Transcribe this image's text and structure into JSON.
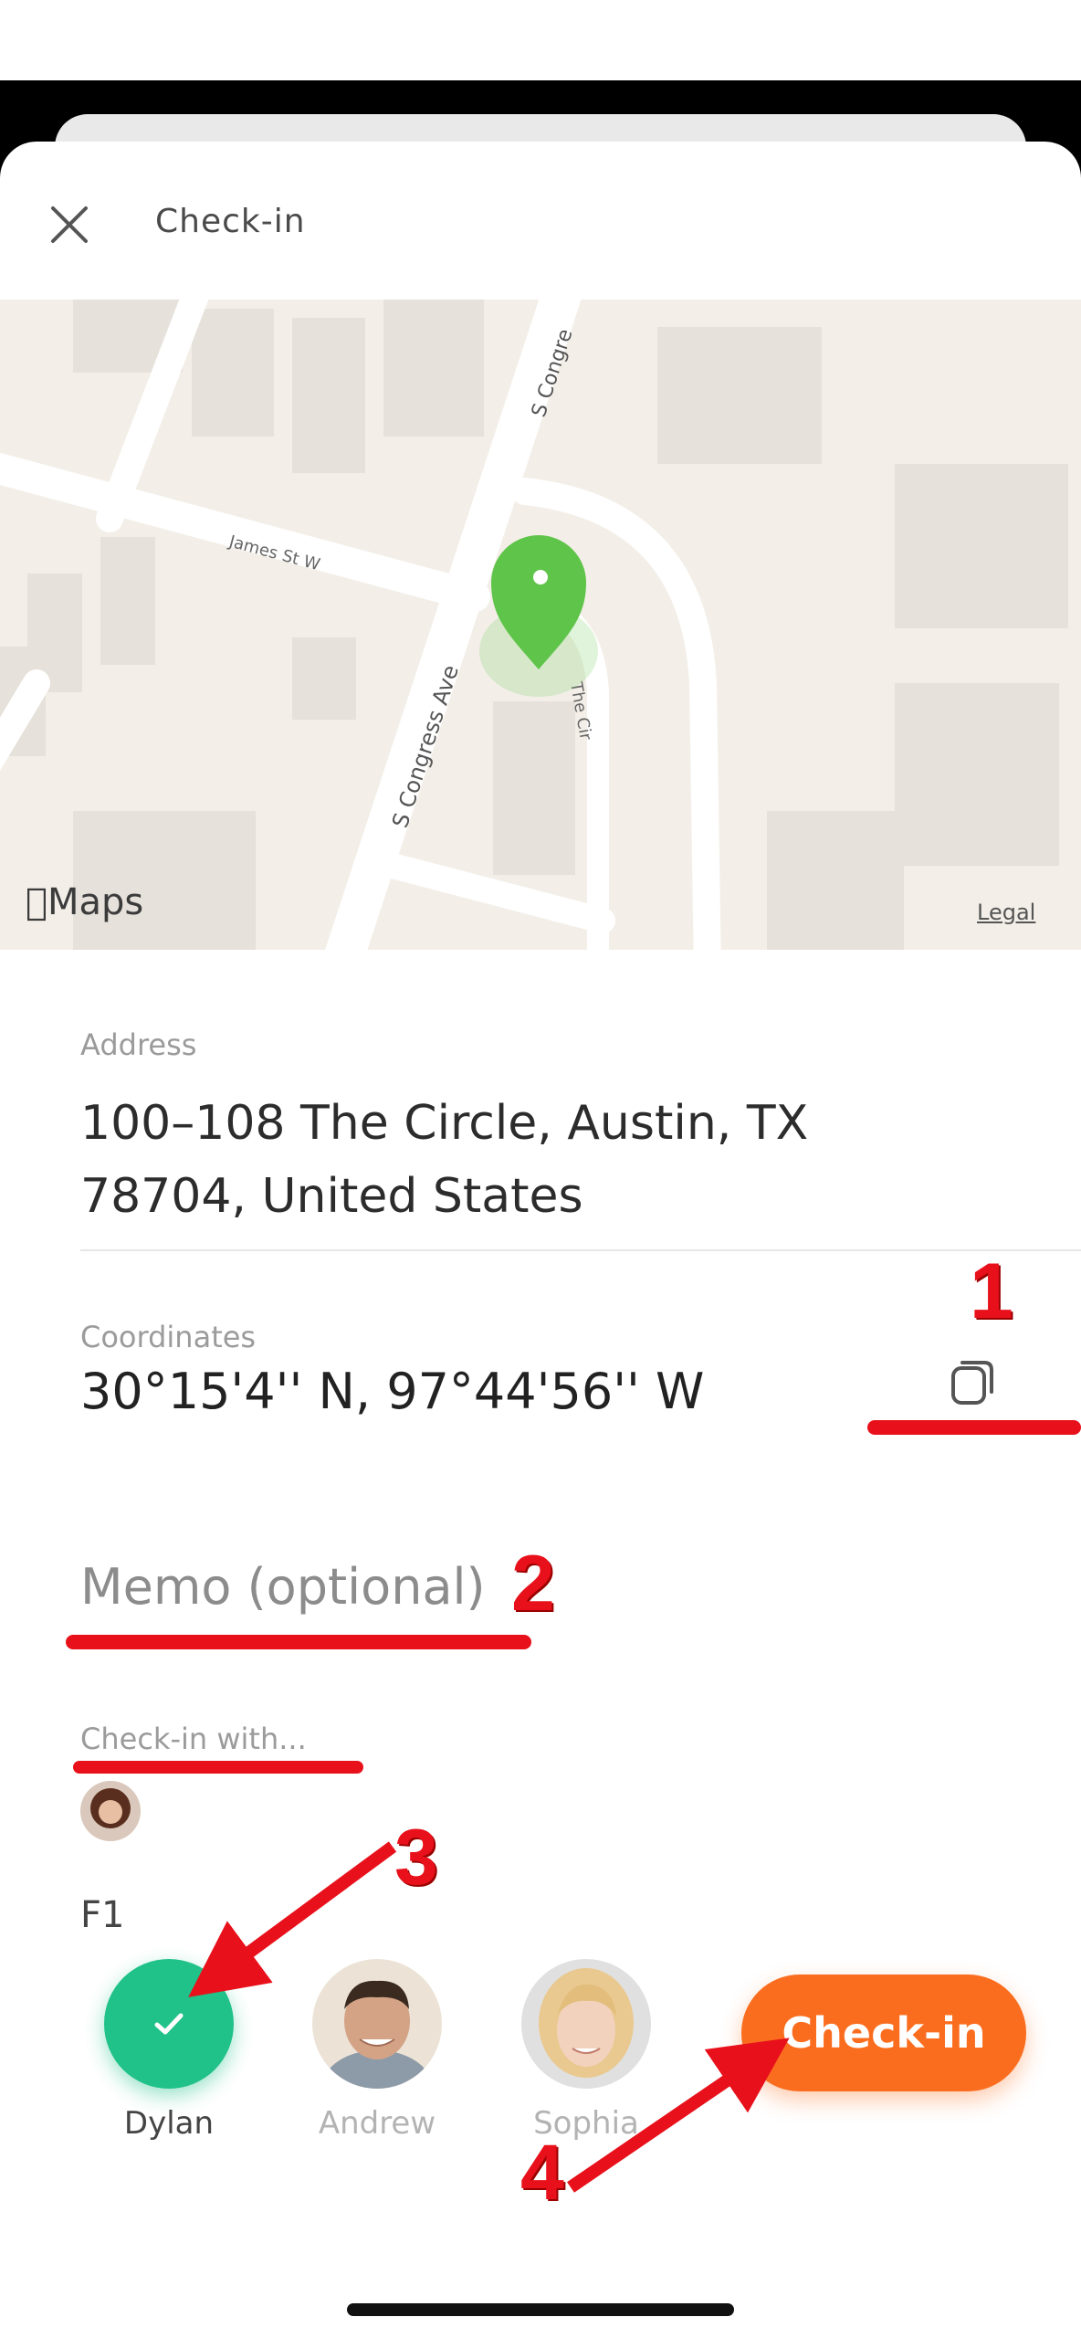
{
  "header": {
    "title": "Check-in",
    "close_icon": "close-icon"
  },
  "map": {
    "street_labels": [
      "S Congre",
      "James St W",
      "S Congress Ave",
      "The Cir"
    ],
    "provider": "Maps",
    "legal": "Legal",
    "pin_color": "#5fc44a"
  },
  "address": {
    "label": "Address",
    "line1": "100–108 The Circle, Austin, TX",
    "line2": "78704, United States"
  },
  "coordinates": {
    "label": "Coordinates",
    "value": "30°15'4'' N, 97°44'56'' W",
    "copy_icon": "copy-icon"
  },
  "memo": {
    "placeholder": "Memo (optional)"
  },
  "checkin_with": {
    "label": "Check-in with...",
    "group_name": "F1",
    "people": [
      {
        "name": "Dylan",
        "selected": true
      },
      {
        "name": "Andrew",
        "selected": false
      },
      {
        "name": "Sophia",
        "selected": false
      }
    ]
  },
  "action": {
    "checkin_label": "Check-in",
    "accent_color": "#fb6d1e"
  },
  "annotations": {
    "labels": [
      "1",
      "2",
      "3",
      "4"
    ],
    "color": "#e8111b"
  }
}
